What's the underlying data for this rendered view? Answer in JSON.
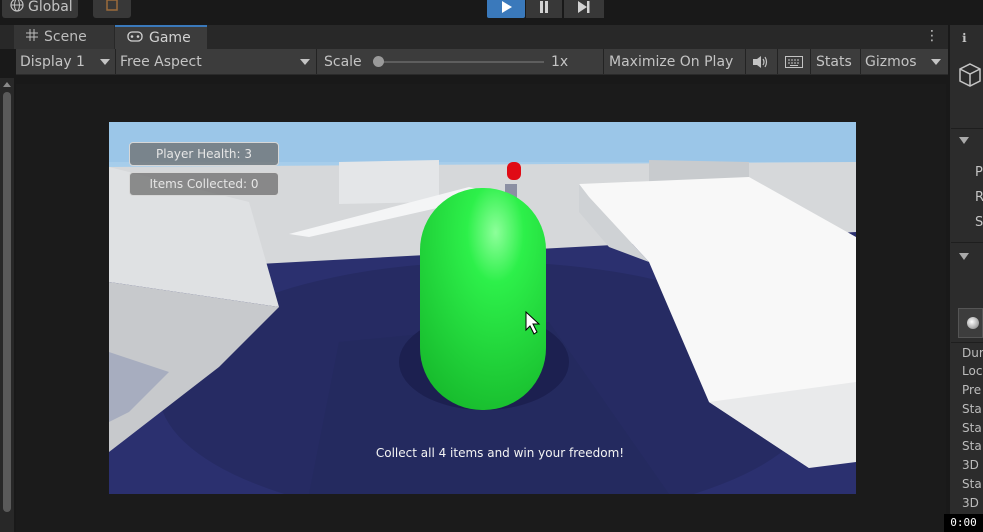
{
  "topbar": {
    "global_label": "Global",
    "play_icon": "play-icon",
    "pause_icon": "pause-icon",
    "step_icon": "step-icon"
  },
  "tabs": [
    {
      "label": "Scene",
      "icon": "grid-icon"
    },
    {
      "label": "Game",
      "icon": "gamepad-icon"
    }
  ],
  "game_toolbar": {
    "display": "Display 1",
    "aspect": "Free Aspect",
    "scale_label": "Scale",
    "scale_value": "1x",
    "maximize": "Maximize On Play",
    "stats": "Stats",
    "gizmos": "Gizmos"
  },
  "hud": {
    "health": "Player Health: 3",
    "items": "Items Collected: 0",
    "message": "Collect all 4 items and win your freedom!"
  },
  "right_panel": {
    "items_top": [
      "P",
      "R",
      "S"
    ],
    "items_bottom": [
      "Dur",
      "Loc",
      "Pre",
      "Sta",
      "Sta",
      "Sta",
      "3D",
      "Sta",
      "3D"
    ]
  },
  "timer": "0:00",
  "colors": {
    "accent": "#3a79bb",
    "player": "#22e33a",
    "floor": "#2a2f6e"
  }
}
